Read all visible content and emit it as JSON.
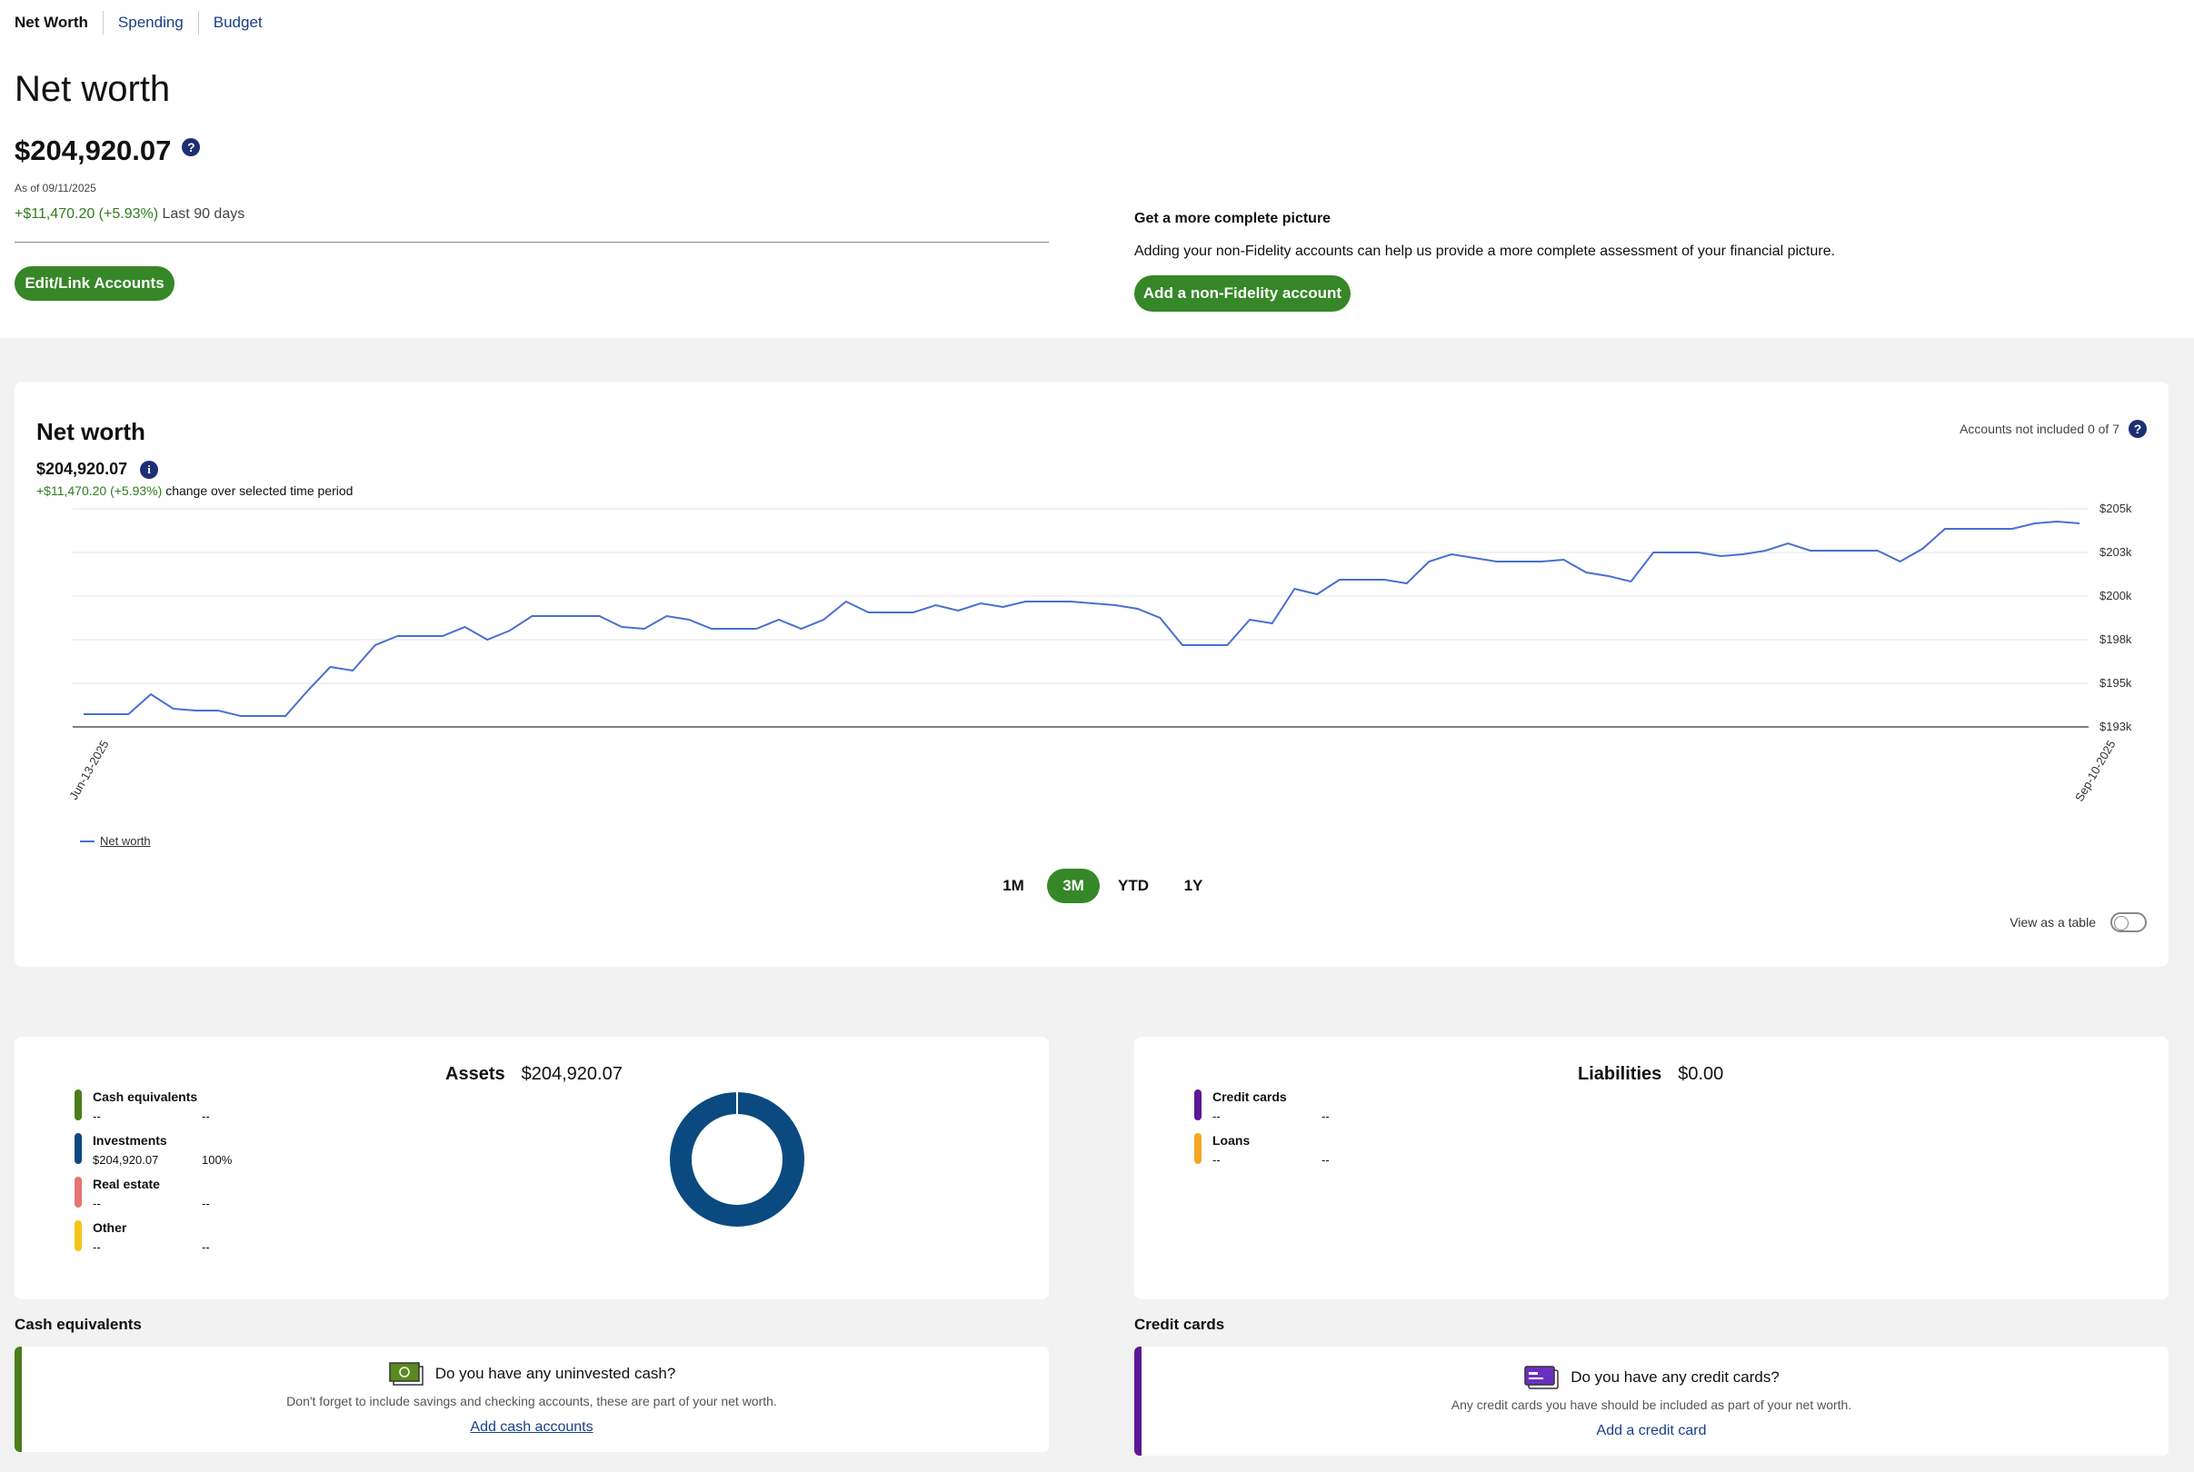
{
  "tabs": [
    "Net Worth",
    "Spending",
    "Budget"
  ],
  "header": {
    "title": "Net worth",
    "value": "$204,920.07",
    "as_of": "As of 09/11/2025",
    "change": "+$11,470.20 (+5.93%)",
    "change_period": "Last 90 days",
    "edit_button": "Edit/Link Accounts"
  },
  "picture": {
    "title": "Get a more complete picture",
    "desc": "Adding your non-Fidelity accounts can help us provide a more complete assessment of your financial picture.",
    "button": "Add a non-Fidelity account"
  },
  "chart_card": {
    "title": "Net worth",
    "value": "$204,920.07",
    "change": "+$11,470.20 (+5.93%)",
    "change_suffix": "change over selected time period",
    "accounts_not_included": "Accounts not included 0 of 7",
    "legend": "Net worth",
    "periods": [
      "1M",
      "3M",
      "YTD",
      "1Y"
    ],
    "active_period": "3M",
    "view_table": "View as a table"
  },
  "chart_data": {
    "type": "line",
    "x_ticks": [
      "Jun-13-2025",
      "Sep-10-2025"
    ],
    "y_ticks": [
      "$193k",
      "$195k",
      "$198k",
      "$200k",
      "$203k",
      "$205k"
    ],
    "ylim": [
      192900,
      204900
    ],
    "series": [
      {
        "name": "Net worth",
        "color": "#4a6fd1",
        "values": [
          193600,
          193600,
          193600,
          194700,
          193900,
          193800,
          193800,
          193500,
          193500,
          193500,
          194900,
          196200,
          196000,
          197400,
          197900,
          197900,
          197900,
          198400,
          197700,
          198200,
          199000,
          199000,
          199000,
          199000,
          198400,
          198300,
          199000,
          198800,
          198300,
          198300,
          198300,
          198800,
          198300,
          198800,
          199800,
          199200,
          199200,
          199200,
          199600,
          199300,
          199700,
          199500,
          199800,
          199800,
          199800,
          199700,
          199600,
          199400,
          198900,
          197400,
          197400,
          197400,
          198800,
          198600,
          200500,
          200200,
          201000,
          201000,
          201000,
          200800,
          202000,
          202400,
          202200,
          202000,
          202000,
          202000,
          202100,
          201400,
          201200,
          200900,
          202500,
          202500,
          202500,
          202300,
          202400,
          202600,
          203000,
          202600,
          202600,
          202600,
          202600,
          202000,
          202700,
          203800,
          203800,
          203800,
          203800,
          204100,
          204200,
          204100
        ]
      }
    ]
  },
  "assets": {
    "label": "Assets",
    "total": "$204,920.07",
    "items": [
      {
        "name": "Cash equivalents",
        "value": "--",
        "pct": "--",
        "color": "#4a7d1a"
      },
      {
        "name": "Investments",
        "value": "$204,920.07",
        "pct": "100%",
        "color": "#0b4a80"
      },
      {
        "name": "Real estate",
        "value": "--",
        "pct": "--",
        "color": "#e57373"
      },
      {
        "name": "Other",
        "value": "--",
        "pct": "--",
        "color": "#f5c518"
      }
    ]
  },
  "liabilities": {
    "label": "Liabilities",
    "total": "$0.00",
    "items": [
      {
        "name": "Credit cards",
        "value": "--",
        "pct": "--",
        "color": "#5b1796"
      },
      {
        "name": "Loans",
        "value": "--",
        "pct": "--",
        "color": "#f5a623"
      }
    ]
  },
  "cash_section": {
    "label": "Cash equivalents",
    "question": "Do you have any uninvested cash?",
    "desc": "Don't forget to include savings and checking accounts, these are part of your net worth.",
    "link": "Add cash accounts",
    "icon": "cash-icon",
    "color": "#4a7d1a"
  },
  "credit_section": {
    "label": "Credit cards",
    "question": "Do you have any credit cards?",
    "desc": "Any credit cards you have should be included as part of your net worth.",
    "link": "Add a credit card",
    "icon": "credit-card-icon",
    "color": "#5b1796"
  }
}
